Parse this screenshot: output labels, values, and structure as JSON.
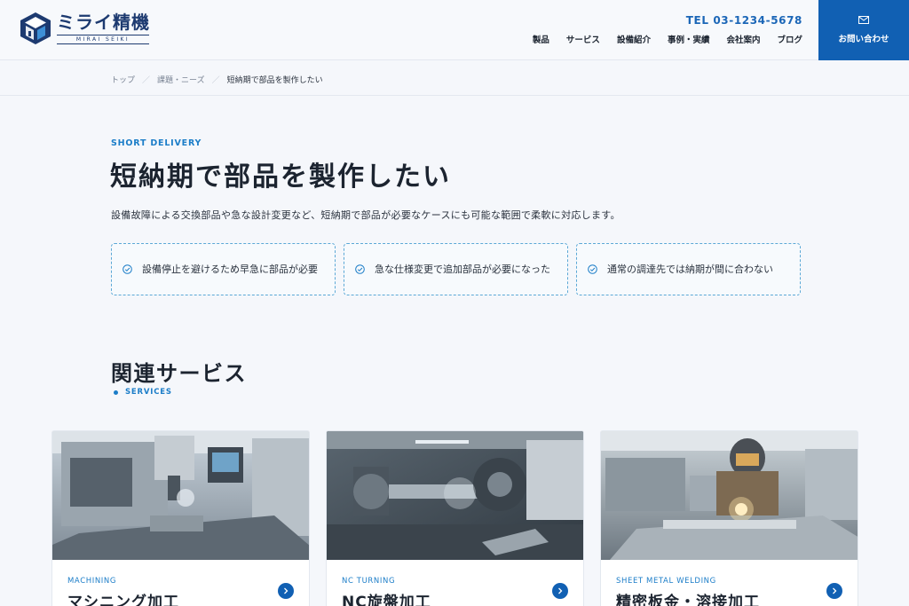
{
  "header": {
    "logo_name": "ミライ精機",
    "logo_sub": "MIRAI SEIKI",
    "tel": "TEL  03-1234-5678",
    "nav": [
      "製品",
      "サービス",
      "設備紹介",
      "事例・実績",
      "会社案内",
      "ブログ"
    ],
    "contact_label": "お問い合わせ"
  },
  "breadcrumb": {
    "items": [
      "トップ",
      "課題・ニーズ",
      "短納期で部品を製作したい"
    ],
    "separator": "／"
  },
  "hero": {
    "eyebrow": "SHORT DELIVERY",
    "title": "短納期で部品を製作したい",
    "lead": "設備故障による交換部品や急な設計変更など、短納期で部品が必要なケースにも可能な範囲で柔軟に対応します。",
    "needs": [
      "設備停止を避けるため早急に部品が必要",
      "急な仕様変更で追加部品が必要になった",
      "通常の調達先では納期が間に合わない"
    ]
  },
  "services": {
    "title": "関連サービス",
    "subtitle": "SERVICES",
    "items": [
      {
        "en": "MACHINING",
        "name": "マシニング加工",
        "image": "machining-center-photo"
      },
      {
        "en": "NC TURNING",
        "name": "NC旋盤加工",
        "image": "nc-lathe-photo"
      },
      {
        "en": "SHEET METAL WELDING",
        "name": "精密板金・溶接加工",
        "image": "welding-photo"
      }
    ]
  },
  "colors": {
    "brand": "#1d3a70",
    "accent": "#1160b3",
    "link": "#1b7dc8"
  },
  "icons": {
    "logo": "logo-mark-icon",
    "contact": "mail-icon",
    "need": "check-circle-icon",
    "card_link": "chevron-right-icon"
  }
}
